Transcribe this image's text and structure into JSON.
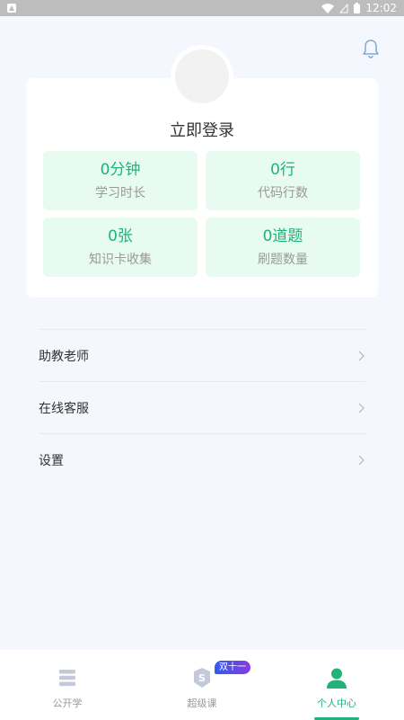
{
  "status_bar": {
    "time": "12:02"
  },
  "profile": {
    "login_title": "立即登录",
    "stats": [
      {
        "value": "0分钟",
        "label": "学习时长"
      },
      {
        "value": "0行",
        "label": "代码行数"
      },
      {
        "value": "0张",
        "label": "知识卡收集"
      },
      {
        "value": "0道题",
        "label": "刷题数量"
      }
    ]
  },
  "menu": {
    "items": [
      {
        "label": "助教老师"
      },
      {
        "label": "在线客服"
      },
      {
        "label": "设置"
      }
    ]
  },
  "bottom_nav": {
    "items": [
      {
        "label": "公开学"
      },
      {
        "label": "超级课",
        "badge": "双十一"
      },
      {
        "label": "个人中心"
      }
    ],
    "active_index": 2
  },
  "colors": {
    "accent": "#1fb37a",
    "tile_bg": "#e7fbf1",
    "page_bg": "#f4f7fd"
  }
}
